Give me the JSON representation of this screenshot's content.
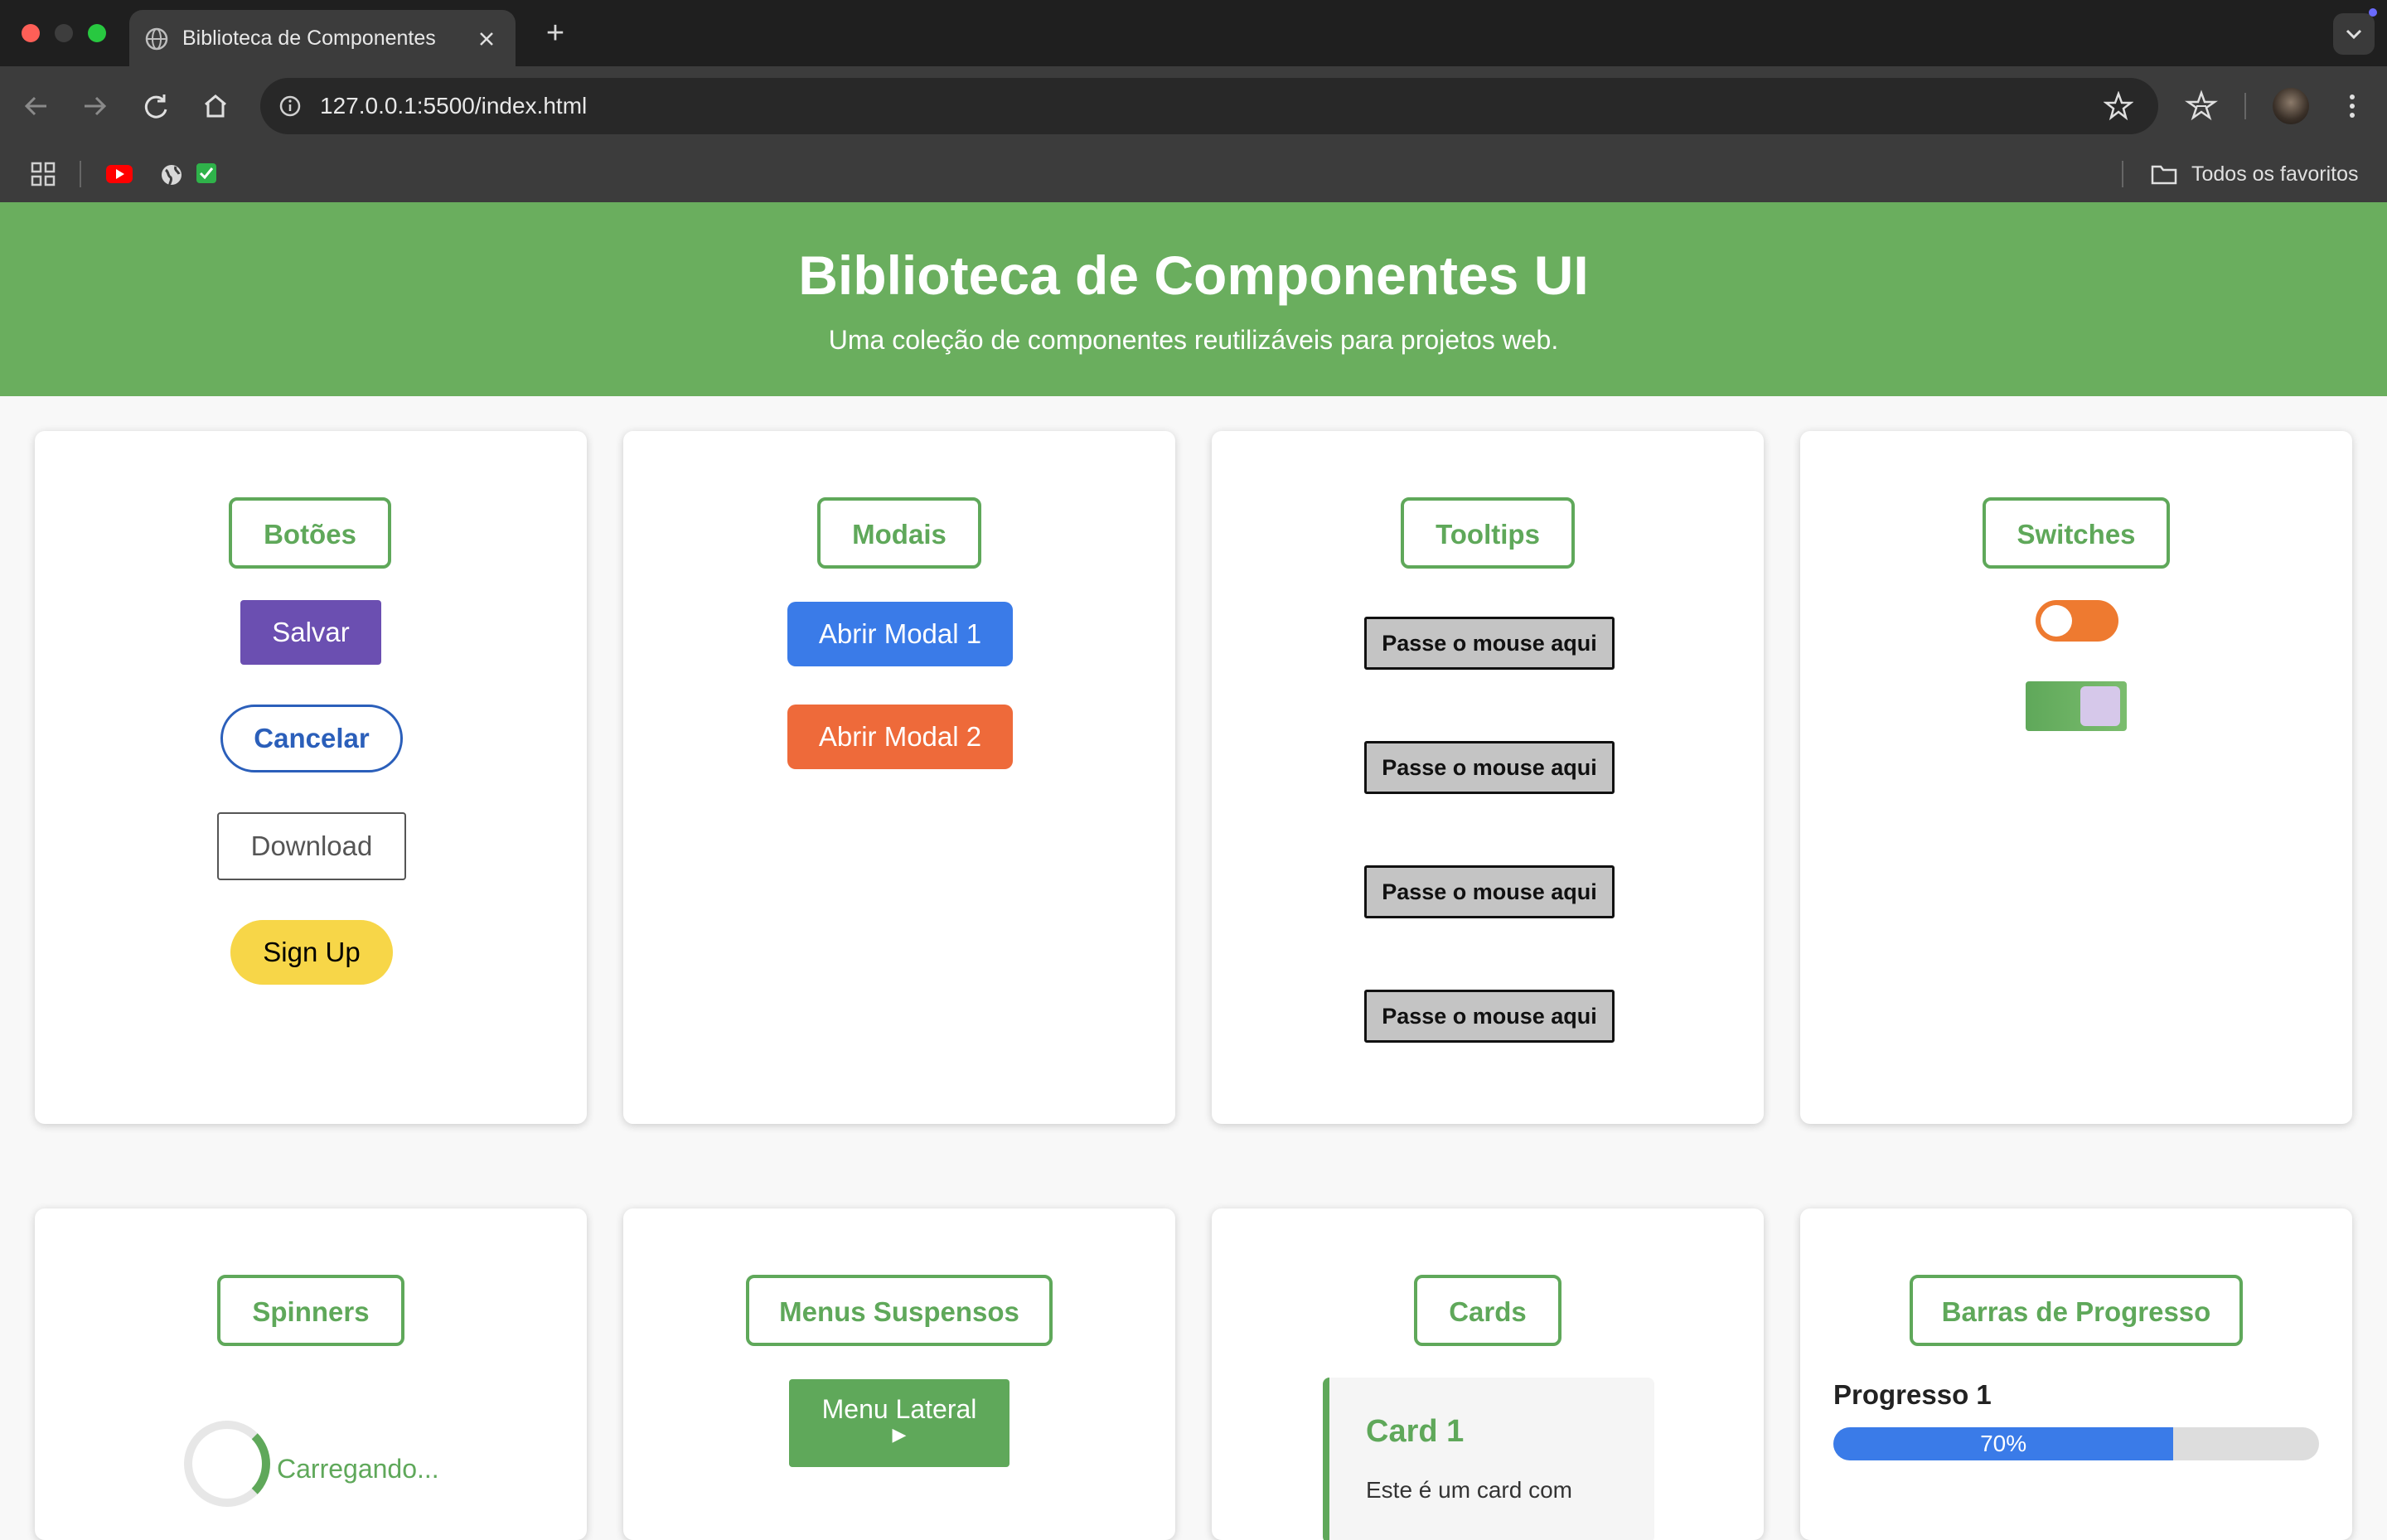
{
  "browser": {
    "tab_title": "Biblioteca de Componentes",
    "url": "127.0.0.1:5500/index.html",
    "bookmarks_label": "Todos os favoritos"
  },
  "hero": {
    "title": "Biblioteca de Componentes UI",
    "subtitle": "Uma coleção de componentes reutilizáveis para projetos web.",
    "color": "#6aae5e"
  },
  "sections": {
    "buttons": {
      "title": "Botões",
      "salvar": "Salvar",
      "cancelar": "Cancelar",
      "download": "Download",
      "signup": "Sign Up"
    },
    "modals": {
      "title": "Modais",
      "modal1": "Abrir Modal 1",
      "modal2": "Abrir Modal 2"
    },
    "tooltips": {
      "title": "Tooltips",
      "items": [
        "Passe o mouse aqui",
        "Passe o mouse aqui",
        "Passe o mouse aqui",
        "Passe o mouse aqui"
      ]
    },
    "switches": {
      "title": "Switches",
      "switch1_on": false,
      "switch2_on": true
    },
    "spinners": {
      "title": "Spinners",
      "loading_text": "Carregando..."
    },
    "dropdowns": {
      "title": "Menus Suspensos",
      "menu_label": "Menu Lateral",
      "menu_arrow": "▶"
    },
    "cards": {
      "title": "Cards",
      "card1_title": "Card 1",
      "card1_text": "Este é um card com"
    },
    "progress": {
      "title": "Barras de Progresso",
      "label": "Progresso 1",
      "value": 70,
      "value_text": "70%"
    }
  },
  "colors": {
    "accent_green": "#5fa85a",
    "purple": "#6b4fb1",
    "blue": "#3a7be8",
    "orange": "#ee6a3a",
    "yellow": "#f7d648"
  }
}
